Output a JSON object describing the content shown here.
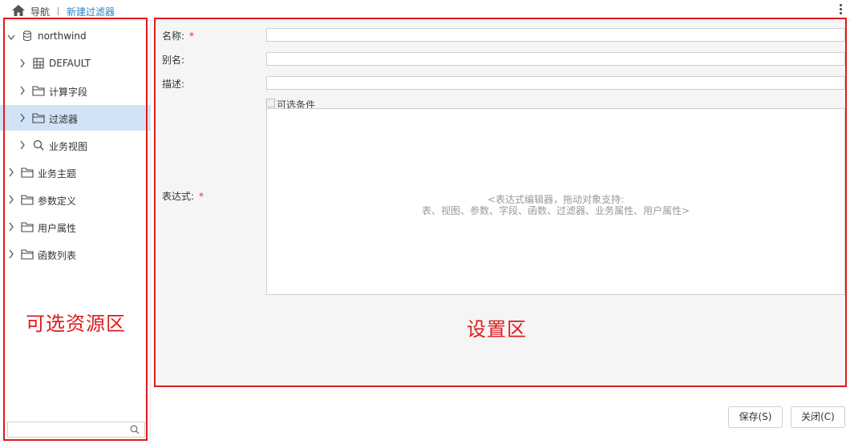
{
  "header": {
    "nav_label": "导航",
    "current_tab": "新建过滤器"
  },
  "tree": {
    "root": "northwind",
    "items": [
      {
        "label": "DEFAULT",
        "icon": "table-icon"
      },
      {
        "label": "计算字段",
        "icon": "folder-icon"
      },
      {
        "label": "过滤器",
        "icon": "folder-icon",
        "selected": true
      },
      {
        "label": "业务视图",
        "icon": "search-icon"
      }
    ],
    "top_folders": [
      {
        "label": "业务主题"
      },
      {
        "label": "参数定义"
      },
      {
        "label": "用户属性"
      },
      {
        "label": "函数列表"
      }
    ],
    "search_placeholder": ""
  },
  "annotations": {
    "left_region": "可选资源区",
    "right_region": "设置区",
    "color": "#e01a1a"
  },
  "form": {
    "name_label": "名称:",
    "alias_label": "别名:",
    "desc_label": "描述:",
    "optional_label": "可选条件",
    "expr_label": "表达式:",
    "required_mark": "*",
    "name_value": "",
    "alias_value": "",
    "desc_value": "",
    "expr_placeholder_line1": "<表达式编辑器，拖动对象支持:",
    "expr_placeholder_line2": "表、视图、参数、字段、函数、过滤器、业务属性、用户属性>"
  },
  "buttons": {
    "save": "保存(S)",
    "close": "关闭(C)"
  },
  "colors": {
    "accent": "#2b84c6",
    "selected_row": "#d2e3f8",
    "required": "#e03030"
  }
}
